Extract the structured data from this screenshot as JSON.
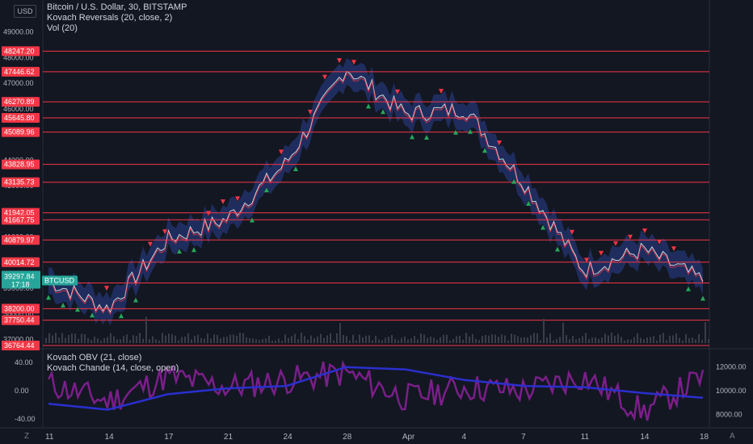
{
  "currency_button": "USD",
  "legend_top": [
    "Bitcoin / U.S. Dollar, 30, BITSTAMP",
    "Kovach Reversals (20, close, 2)",
    "Vol (20)"
  ],
  "legend_bottom": [
    "Kovach OBV (21, close)",
    "Kovach Chande (14, close, open)"
  ],
  "bottom_left_icon": "Z",
  "bottom_right_icon": "A",
  "colors": {
    "background": "#131722",
    "level_line": "#f23645",
    "band": "#2a3f8f",
    "price": "#d1d4dc",
    "buy_marker": "#26a65b",
    "sell_marker": "#f23645",
    "obv": "#2a2fcf",
    "chande": "#7b1f8a",
    "last_price_tag": "#26a69a"
  },
  "price_ticks": [
    "49000.00",
    "48000.00",
    "47000.00",
    "46000.00",
    "45000.00",
    "44000.00",
    "43000.00",
    "42000.00",
    "41000.00",
    "40000.00",
    "39000.00",
    "38000.00",
    "37000.00"
  ],
  "level_labels": [
    "48247.20",
    "47446.62",
    "46270.89",
    "45645.80",
    "45089.96",
    "43828.95",
    "43135.73",
    "41942.05",
    "41667.75",
    "40879.97",
    "40014.72",
    "39205.02",
    "38200.00",
    "37750.44",
    "36764.44"
  ],
  "last_price": {
    "value": "39297.84",
    "symbol": "BTCUSD",
    "countdown": "17:18"
  },
  "lower_ticks_left": [
    "40.00",
    "0.00",
    "-40.00"
  ],
  "lower_ticks_right": [
    "12000.00",
    "10000.00",
    "8000.00"
  ],
  "x_labels": [
    "11",
    "14",
    "17",
    "21",
    "24",
    "28",
    "Apr",
    "4",
    "7",
    "11",
    "14",
    "18"
  ],
  "chart_data": [
    {
      "type": "line",
      "title": "Bitcoin / U.S. Dollar, 30, BITSTAMP",
      "y_range": [
        36700,
        49300
      ],
      "x": [
        "11",
        "14",
        "17",
        "21",
        "24",
        "28",
        "Apr",
        "4",
        "7",
        "11",
        "14",
        "18"
      ],
      "series": [
        {
          "name": "Bitcoin / U.S. Dollar",
          "values": [
            39300,
            38200,
            40900,
            41700,
            43900,
            47600,
            45800,
            46000,
            43100,
            39700,
            40500,
            39300
          ]
        }
      ],
      "horizontal_levels": [
        48247.2,
        47446.62,
        46270.89,
        45645.8,
        45089.96,
        43828.95,
        43135.73,
        41942.05,
        41667.75,
        40879.97,
        40014.72,
        39205.02,
        38200.0,
        37750.44,
        36764.44
      ]
    },
    {
      "type": "line",
      "title": "",
      "y_range_left": [
        -40,
        40
      ],
      "y_range_right": [
        8000,
        12000
      ],
      "x": [
        "11",
        "14",
        "17",
        "21",
        "24",
        "28",
        "Apr",
        "4",
        "7",
        "11",
        "14",
        "18"
      ],
      "series": [
        {
          "name": "Kovach OBV (21, close)",
          "values": [
            8900,
            8400,
            9700,
            10200,
            10400,
            12000,
            11800,
            10900,
            10400,
            10300,
            9800,
            9400
          ]
        },
        {
          "name": "Kovach Chande (14, close, open)",
          "values": [
            10,
            -15,
            20,
            5,
            15,
            25,
            -10,
            5,
            0,
            20,
            -30,
            20
          ]
        }
      ]
    }
  ]
}
